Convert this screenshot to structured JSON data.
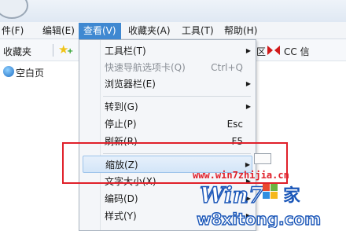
{
  "menubar": {
    "items": [
      {
        "label": "件(F)"
      },
      {
        "label": "编辑(E)"
      },
      {
        "label": "查看(V)"
      },
      {
        "label": "收藏夹(A)"
      },
      {
        "label": "工具(T)"
      },
      {
        "label": "帮助(H)"
      }
    ]
  },
  "favbar": {
    "favorites_label": "收藏夹",
    "region_text": "区",
    "cc_label": "CC 信"
  },
  "tab": {
    "label": "空白页"
  },
  "view_menu": {
    "items": [
      {
        "label": "工具栏(T)",
        "shortcut": "",
        "submenu": true,
        "disabled": false
      },
      {
        "label": "快速导航选项卡(Q)",
        "shortcut": "Ctrl+Q",
        "submenu": false,
        "disabled": true
      },
      {
        "label": "浏览器栏(E)",
        "shortcut": "",
        "submenu": true,
        "disabled": false
      },
      {
        "label": "转到(G)",
        "shortcut": "",
        "submenu": true,
        "disabled": false
      },
      {
        "label": "停止(P)",
        "shortcut": "Esc",
        "submenu": false,
        "disabled": false
      },
      {
        "label": "刷新(R)",
        "shortcut": "F5",
        "submenu": false,
        "disabled": false
      },
      {
        "label": "缩放(Z)",
        "shortcut": "",
        "submenu": true,
        "disabled": false
      },
      {
        "label": "文字大小(X)",
        "shortcut": "",
        "submenu": true,
        "disabled": false
      },
      {
        "label": "编码(D)",
        "shortcut": "",
        "submenu": true,
        "disabled": false
      },
      {
        "label": "样式(Y)",
        "shortcut": "",
        "submenu": true,
        "disabled": false
      }
    ]
  },
  "watermark": {
    "url": "www.win7zhijia.cn",
    "site": "w8xitong.com",
    "brand": "Win7"
  },
  "colors": {
    "menu_highlight": "#3f88d1",
    "annotation_red": "#e0202a",
    "watermark_blue": "#1a56b8"
  }
}
